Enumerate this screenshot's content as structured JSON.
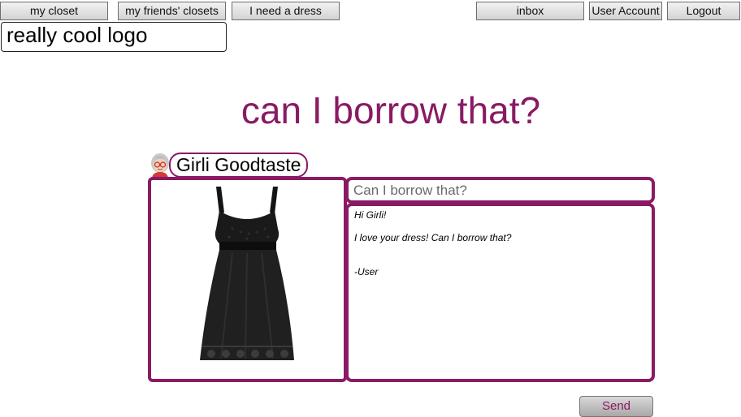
{
  "nav": {
    "my_closet": "my closet",
    "friends_closets": "my friends' closets",
    "need_dress": "I need a dress",
    "inbox": "inbox",
    "user_account": "User Account",
    "logout": "Logout"
  },
  "logo": {
    "text": "really cool logo"
  },
  "headline": "can I borrow that?",
  "recipient": {
    "name": "Girli Goodtaste"
  },
  "item": {
    "image": "black-sleeveless-eyelet-dress"
  },
  "compose": {
    "subject": "Can I borrow that?",
    "body": [
      "Hi Girli!",
      "I love your dress! Can I borrow that?",
      "-User"
    ]
  },
  "send_label": "Send",
  "colors": {
    "accent": "#8a1a63"
  }
}
